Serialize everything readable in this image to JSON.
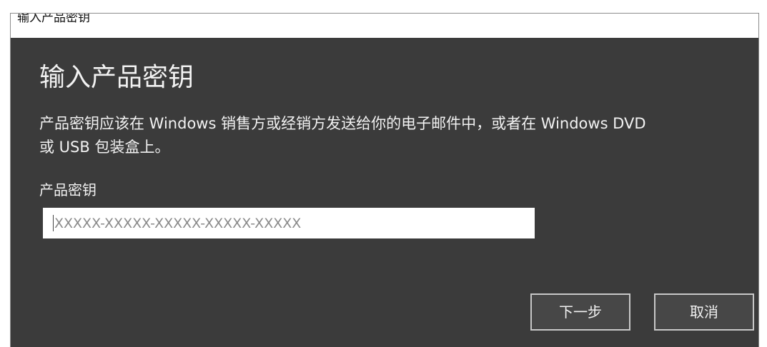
{
  "window": {
    "title": "输入产品密钥"
  },
  "dialog": {
    "heading": "输入产品密钥",
    "description_lines": [
      "产品密钥应该在 Windows 销售方或经销方发送给你的电子邮件中，或者在 Windows DVD",
      "或 USB 包装盒上。"
    ],
    "field_label": "产品密钥",
    "product_key_input": {
      "placeholder": "XXXXX-XXXXX-XXXXX-XXXXX-XXXXX"
    },
    "buttons": {
      "next_label": "下一步",
      "cancel_label": "取消"
    }
  },
  "colors": {
    "dialog_background": "#3b3b3b",
    "text": "#f2f2f2",
    "input_background": "#ffffff",
    "placeholder": "#8a8a8a",
    "button_border": "#c8c8c8",
    "button_background": "#474747"
  }
}
